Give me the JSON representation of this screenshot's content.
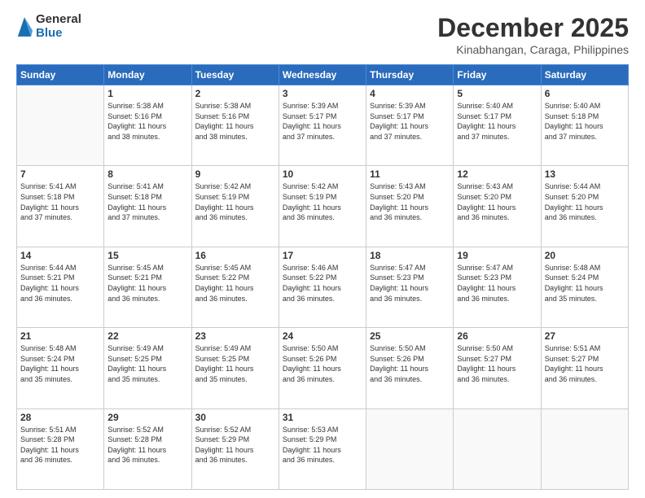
{
  "logo": {
    "general": "General",
    "blue": "Blue"
  },
  "title": "December 2025",
  "subtitle": "Kinabhangan, Caraga, Philippines",
  "days_header": [
    "Sunday",
    "Monday",
    "Tuesday",
    "Wednesday",
    "Thursday",
    "Friday",
    "Saturday"
  ],
  "weeks": [
    [
      {
        "day": "",
        "info": ""
      },
      {
        "day": "1",
        "info": "Sunrise: 5:38 AM\nSunset: 5:16 PM\nDaylight: 11 hours\nand 38 minutes."
      },
      {
        "day": "2",
        "info": "Sunrise: 5:38 AM\nSunset: 5:16 PM\nDaylight: 11 hours\nand 38 minutes."
      },
      {
        "day": "3",
        "info": "Sunrise: 5:39 AM\nSunset: 5:17 PM\nDaylight: 11 hours\nand 37 minutes."
      },
      {
        "day": "4",
        "info": "Sunrise: 5:39 AM\nSunset: 5:17 PM\nDaylight: 11 hours\nand 37 minutes."
      },
      {
        "day": "5",
        "info": "Sunrise: 5:40 AM\nSunset: 5:17 PM\nDaylight: 11 hours\nand 37 minutes."
      },
      {
        "day": "6",
        "info": "Sunrise: 5:40 AM\nSunset: 5:18 PM\nDaylight: 11 hours\nand 37 minutes."
      }
    ],
    [
      {
        "day": "7",
        "info": "Sunrise: 5:41 AM\nSunset: 5:18 PM\nDaylight: 11 hours\nand 37 minutes."
      },
      {
        "day": "8",
        "info": "Sunrise: 5:41 AM\nSunset: 5:18 PM\nDaylight: 11 hours\nand 37 minutes."
      },
      {
        "day": "9",
        "info": "Sunrise: 5:42 AM\nSunset: 5:19 PM\nDaylight: 11 hours\nand 36 minutes."
      },
      {
        "day": "10",
        "info": "Sunrise: 5:42 AM\nSunset: 5:19 PM\nDaylight: 11 hours\nand 36 minutes."
      },
      {
        "day": "11",
        "info": "Sunrise: 5:43 AM\nSunset: 5:20 PM\nDaylight: 11 hours\nand 36 minutes."
      },
      {
        "day": "12",
        "info": "Sunrise: 5:43 AM\nSunset: 5:20 PM\nDaylight: 11 hours\nand 36 minutes."
      },
      {
        "day": "13",
        "info": "Sunrise: 5:44 AM\nSunset: 5:20 PM\nDaylight: 11 hours\nand 36 minutes."
      }
    ],
    [
      {
        "day": "14",
        "info": "Sunrise: 5:44 AM\nSunset: 5:21 PM\nDaylight: 11 hours\nand 36 minutes."
      },
      {
        "day": "15",
        "info": "Sunrise: 5:45 AM\nSunset: 5:21 PM\nDaylight: 11 hours\nand 36 minutes."
      },
      {
        "day": "16",
        "info": "Sunrise: 5:45 AM\nSunset: 5:22 PM\nDaylight: 11 hours\nand 36 minutes."
      },
      {
        "day": "17",
        "info": "Sunrise: 5:46 AM\nSunset: 5:22 PM\nDaylight: 11 hours\nand 36 minutes."
      },
      {
        "day": "18",
        "info": "Sunrise: 5:47 AM\nSunset: 5:23 PM\nDaylight: 11 hours\nand 36 minutes."
      },
      {
        "day": "19",
        "info": "Sunrise: 5:47 AM\nSunset: 5:23 PM\nDaylight: 11 hours\nand 36 minutes."
      },
      {
        "day": "20",
        "info": "Sunrise: 5:48 AM\nSunset: 5:24 PM\nDaylight: 11 hours\nand 35 minutes."
      }
    ],
    [
      {
        "day": "21",
        "info": "Sunrise: 5:48 AM\nSunset: 5:24 PM\nDaylight: 11 hours\nand 35 minutes."
      },
      {
        "day": "22",
        "info": "Sunrise: 5:49 AM\nSunset: 5:25 PM\nDaylight: 11 hours\nand 35 minutes."
      },
      {
        "day": "23",
        "info": "Sunrise: 5:49 AM\nSunset: 5:25 PM\nDaylight: 11 hours\nand 35 minutes."
      },
      {
        "day": "24",
        "info": "Sunrise: 5:50 AM\nSunset: 5:26 PM\nDaylight: 11 hours\nand 36 minutes."
      },
      {
        "day": "25",
        "info": "Sunrise: 5:50 AM\nSunset: 5:26 PM\nDaylight: 11 hours\nand 36 minutes."
      },
      {
        "day": "26",
        "info": "Sunrise: 5:50 AM\nSunset: 5:27 PM\nDaylight: 11 hours\nand 36 minutes."
      },
      {
        "day": "27",
        "info": "Sunrise: 5:51 AM\nSunset: 5:27 PM\nDaylight: 11 hours\nand 36 minutes."
      }
    ],
    [
      {
        "day": "28",
        "info": "Sunrise: 5:51 AM\nSunset: 5:28 PM\nDaylight: 11 hours\nand 36 minutes."
      },
      {
        "day": "29",
        "info": "Sunrise: 5:52 AM\nSunset: 5:28 PM\nDaylight: 11 hours\nand 36 minutes."
      },
      {
        "day": "30",
        "info": "Sunrise: 5:52 AM\nSunset: 5:29 PM\nDaylight: 11 hours\nand 36 minutes."
      },
      {
        "day": "31",
        "info": "Sunrise: 5:53 AM\nSunset: 5:29 PM\nDaylight: 11 hours\nand 36 minutes."
      },
      {
        "day": "",
        "info": ""
      },
      {
        "day": "",
        "info": ""
      },
      {
        "day": "",
        "info": ""
      }
    ]
  ]
}
